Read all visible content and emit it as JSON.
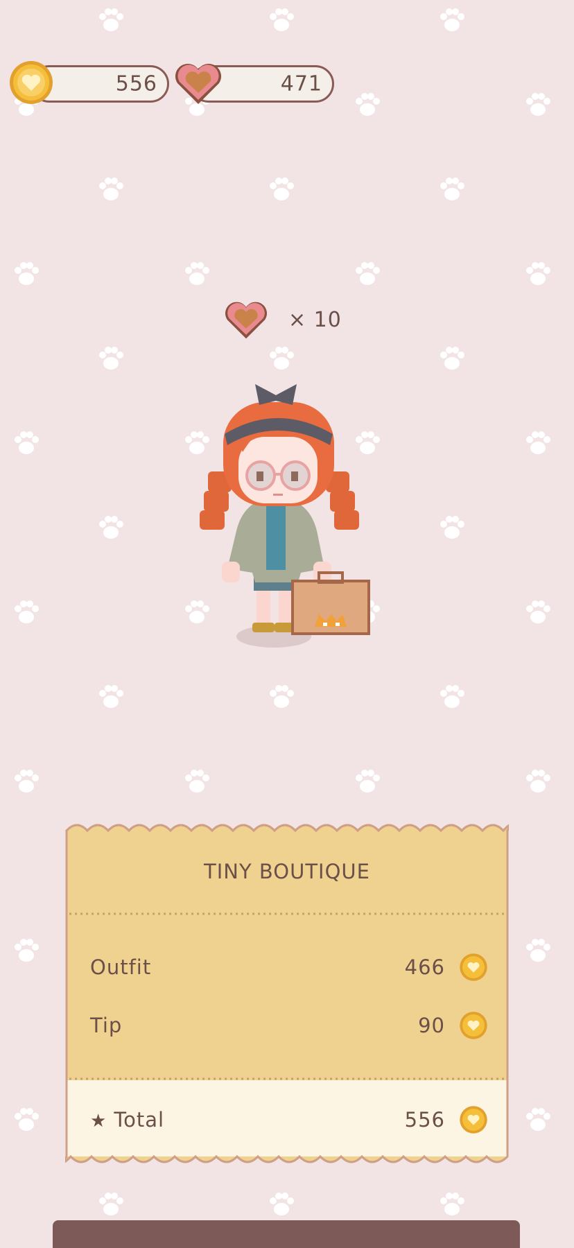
{
  "hud": {
    "coins": "556",
    "hearts": "471"
  },
  "reward": {
    "label": "× 10"
  },
  "receipt": {
    "shop_name": "TINY BOUTIQUE",
    "rows": [
      {
        "label": "Outfit",
        "amount": "466"
      },
      {
        "label": "Tip",
        "amount": "90"
      }
    ],
    "total_label": "Total",
    "total_amount": "556"
  },
  "icons": {
    "coin": "coin-icon",
    "heart": "heart-cookie-icon",
    "star": "star-icon",
    "paw": "paw-icon"
  },
  "colors": {
    "background": "#f2e4e4",
    "receipt": "#f0d290",
    "receipt_footer": "#fdf5e4",
    "coin": "#f5bf3c",
    "heart": "#e98a8e"
  }
}
